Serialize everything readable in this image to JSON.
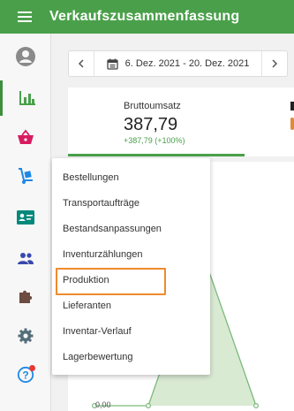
{
  "app": {
    "title": "Verkaufszusammenfassung"
  },
  "topbar": {
    "menu_icon": "hamburger-menu-icon"
  },
  "sidebar": {
    "items": [
      {
        "name": "profile",
        "icon": "avatar-icon",
        "active": false,
        "color": "#888888"
      },
      {
        "name": "reports",
        "icon": "bar-chart-icon",
        "active": true,
        "color": "#4aa04a"
      },
      {
        "name": "sales",
        "icon": "basket-icon",
        "active": false,
        "color": "#d81b60"
      },
      {
        "name": "inventory",
        "icon": "hand-truck-icon",
        "active": false,
        "color": "#1e88e5"
      },
      {
        "name": "customers-card",
        "icon": "id-card-icon",
        "active": false,
        "color": "#00897b"
      },
      {
        "name": "people",
        "icon": "people-icon",
        "active": false,
        "color": "#3949ab"
      },
      {
        "name": "addons",
        "icon": "puzzle-icon",
        "active": false,
        "color": "#6d4c41"
      },
      {
        "name": "settings",
        "icon": "gear-icon",
        "active": false,
        "color": "#546e7a"
      },
      {
        "name": "help",
        "icon": "help-icon",
        "active": false,
        "color": "#1e88e5"
      }
    ]
  },
  "date_range": {
    "label": "6. Dez. 2021 - 20. Dez. 2021",
    "prev_icon": "chevron-left-icon",
    "next_icon": "chevron-right-icon",
    "calendar_icon": "calendar-icon"
  },
  "kpi": {
    "label": "Bruttoumsatz",
    "value": "387,79",
    "change": "+387,79 (+100%)"
  },
  "chart": {
    "y_tick": "0,00"
  },
  "chart_data": {
    "type": "area",
    "series": [
      {
        "values": [
          0,
          0,
          387.79,
          0
        ]
      }
    ],
    "ylim": [
      0,
      387.79
    ],
    "accent_color": "#4aa04a"
  },
  "dropdown": {
    "items": [
      {
        "label": "Bestellungen",
        "highlighted": false
      },
      {
        "label": "Transportaufträge",
        "highlighted": false
      },
      {
        "label": "Bestandsanpassungen",
        "highlighted": false
      },
      {
        "label": "Inventurzählungen",
        "highlighted": false
      },
      {
        "label": "Produktion",
        "highlighted": true
      },
      {
        "label": "Lieferanten",
        "highlighted": false
      },
      {
        "label": "Inventar-Verlauf",
        "highlighted": false
      },
      {
        "label": "Lagerbewertung",
        "highlighted": false
      }
    ],
    "highlight_color": "#f08a2c"
  },
  "colors": {
    "brand": "#4aa04a",
    "topbar": "#4aa04a"
  }
}
